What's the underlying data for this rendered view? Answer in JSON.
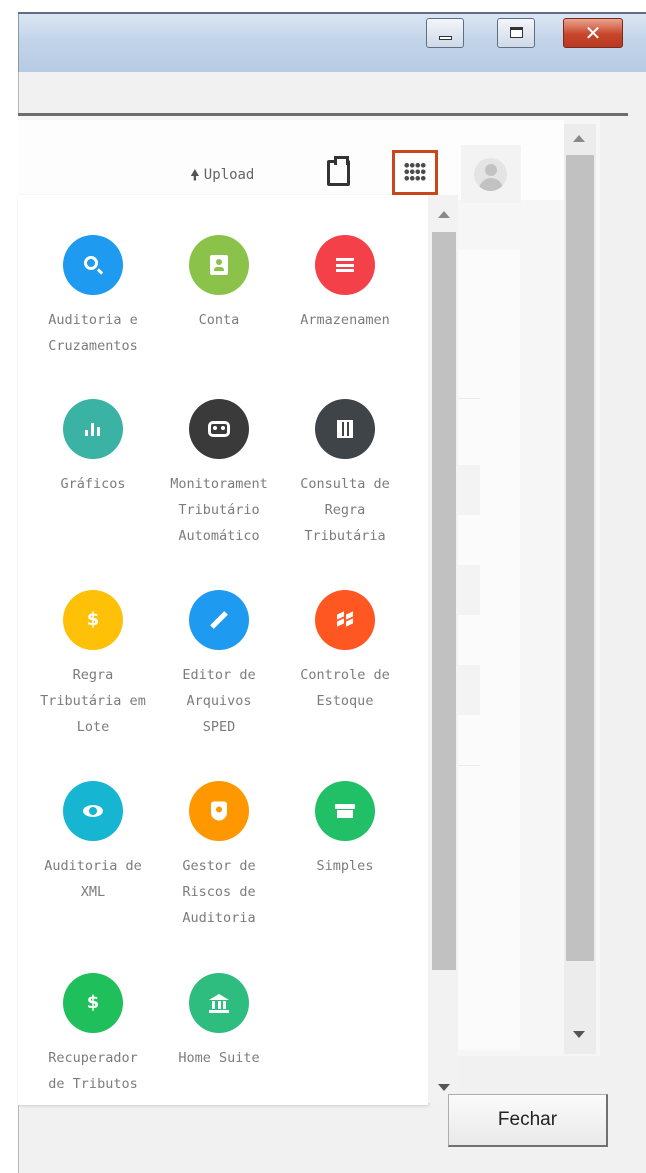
{
  "window": {
    "buttons": {
      "minimize": "minimize",
      "maximize": "maximize",
      "close": "✕"
    }
  },
  "toolbar": {
    "upload_label": "Upload",
    "upload_icon": "upload-arrow-icon",
    "clipboard_icon": "clipboard-icon",
    "apps_icon": "apps-grid-icon",
    "avatar_icon": "user-avatar-icon",
    "apps_button_highlight": "#c9471a"
  },
  "apps_panel": {
    "apps": [
      {
        "label": "Auditoria e\nCruzamentos",
        "icon": "search-icon",
        "color": "#1e9bf0"
      },
      {
        "label": "Conta",
        "icon": "badge-icon",
        "color": "#8bc34a"
      },
      {
        "label": "Armazenamen",
        "icon": "menu-icon",
        "color": "#f44149"
      },
      {
        "label": "Gráficos",
        "icon": "bar-chart-icon",
        "color": "#3bb3a4"
      },
      {
        "label": "Monitorament\nTributário\nAutomático",
        "icon": "robot-icon",
        "color": "#3a3a3a"
      },
      {
        "label": "Consulta de\nRegra\nTributária",
        "icon": "map-icon",
        "color": "#3f4449"
      },
      {
        "label": "Regra\nTributária em\nLote",
        "icon": "money-off-icon",
        "color": "#ffc107"
      },
      {
        "label": "Editor de\nArquivos\nSPED",
        "icon": "pencil-icon",
        "color": "#1e9bf0"
      },
      {
        "label": "Controle de\nEstoque",
        "icon": "dropbox-icon",
        "color": "#ff5722"
      },
      {
        "label": "Auditoria de\nXML",
        "icon": "eye-icon",
        "color": "#16b5d1"
      },
      {
        "label": "Gestor de\nRiscos de\nAuditoria",
        "icon": "shield-icon",
        "color": "#ff9800"
      },
      {
        "label": "Simples",
        "icon": "store-icon",
        "color": "#21bf66"
      },
      {
        "label": "Recuperador\nde Tributos",
        "icon": "dollar-icon",
        "color": "#1fbf5c",
        "glyph": "$"
      },
      {
        "label": "Home Suite",
        "icon": "bank-icon",
        "color": "#2ebd7f"
      }
    ]
  },
  "footer": {
    "close_label": "Fechar"
  }
}
